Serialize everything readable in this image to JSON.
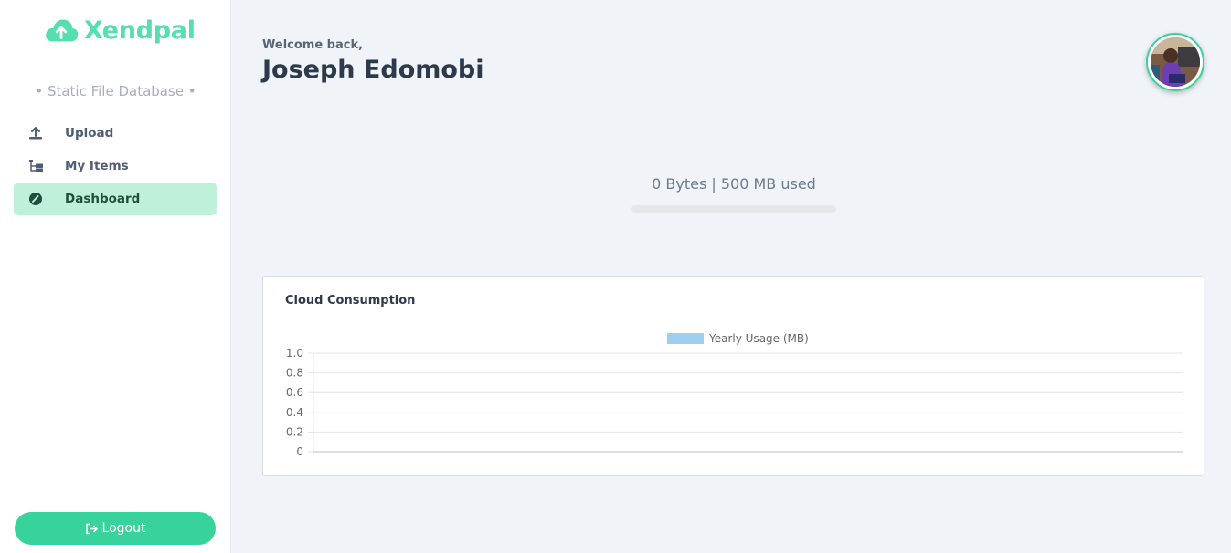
{
  "brand": {
    "name": "Xendpal",
    "tagline": "• Static File Database •",
    "color": "#55dfae"
  },
  "nav": {
    "items": [
      {
        "label": "Upload",
        "icon": "upload-icon"
      },
      {
        "label": "My Items",
        "icon": "folder-tree-icon"
      },
      {
        "label": "Dashboard",
        "icon": "gauge-icon",
        "active": true
      }
    ]
  },
  "logout": {
    "label": "Logout",
    "icon": "sign-out-icon"
  },
  "header": {
    "welcome": "Welcome back,",
    "user_name": "Joseph Edomobi"
  },
  "usage": {
    "text": "0 Bytes | 500 MB used",
    "used_fraction": 0
  },
  "card": {
    "title": "Cloud Consumption"
  },
  "chart_data": {
    "type": "bar",
    "categories": [],
    "series": [
      {
        "name": "Yearly Usage (MB)",
        "values": [],
        "color": "#9ccff2"
      }
    ],
    "ylim": [
      0,
      1
    ],
    "yticks": [
      "1.0",
      "0.8",
      "0.6",
      "0.4",
      "0.2",
      "0"
    ],
    "grid": true,
    "legend_position": "top"
  }
}
